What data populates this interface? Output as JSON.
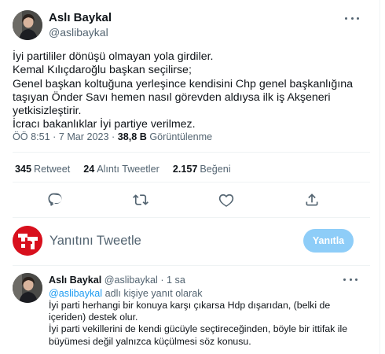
{
  "tweet": {
    "author_name": "Aslı Baykal",
    "author_handle": "@aslibaykal",
    "lines": [
      "İyi partililer dönüşü olmayan yola girdiler.",
      "Kemal Kılıçdaroğlu başkan seçilirse;",
      "Genel başkan koltuğuna yerleşince kendisini Chp genel başkanlığına",
      "taşıyan Önder Savı hemen nasıl görevden aldıysa ilk iş Akşeneri",
      "yetkisizleştirir.",
      "İcracı bakanlıklar İyi partiye verilmez."
    ],
    "time": "ÖÖ 8:51",
    "date": "7 Mar 2023",
    "separator": "·",
    "views_count": "38,8 B",
    "views_label": "Görüntülenme"
  },
  "stats": {
    "retweets_count": "345",
    "retweets_label": "Retweet",
    "quotes_count": "24",
    "quotes_label": "Alıntı Tweetler",
    "likes_count": "2.157",
    "likes_label": "Beğeni"
  },
  "actions": [
    "reply-icon",
    "retweet-icon",
    "like-icon",
    "share-icon"
  ],
  "composer": {
    "placeholder": "Yanıtını Tweetle",
    "button_label": "Yanıtla"
  },
  "reply": {
    "author_name": "Aslı Baykal",
    "author_handle": "@aslibaykal",
    "time": "1 sa",
    "separator": "·",
    "replying_mention": "@aslibaykal",
    "replying_suffix": "adlı kişiye yanıt olarak",
    "lines": [
      "İyi parti herhangi bir konuya karşı çıkarsa Hdp dışarıdan, (belki de",
      "içeriden) destek olur.",
      "İyi parti vekillerini de kendi gücüyle seçtireceğinden, böyle bir ittifak ile",
      "büyümesi değil yalnızca küçülmesi söz konusu."
    ]
  },
  "colors": {
    "text_primary": "#0f1419",
    "text_secondary": "#536471",
    "accent": "#1d9bf0",
    "reply_button_disabled": "#8ecdf8",
    "composer_logo": "#d8101d"
  }
}
